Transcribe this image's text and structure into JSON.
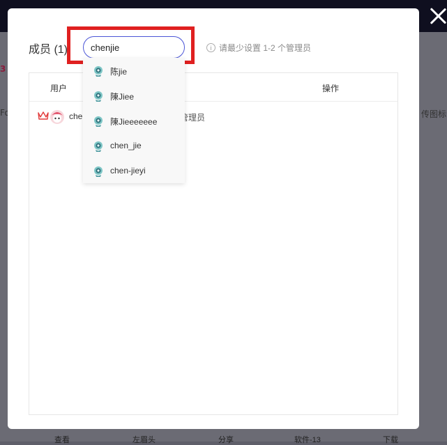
{
  "modal": {
    "title": "成员 (1)",
    "hint": "请最少设置 1-2 个管理员",
    "search": {
      "value": "chenjie"
    }
  },
  "table": {
    "columns": [
      "用户",
      "操作"
    ],
    "rows": [
      {
        "name": "chen",
        "role": "管理员"
      }
    ]
  },
  "dropdown": {
    "items": [
      "陈jie",
      "陳Jiee",
      "陳Jieeeeeee",
      "chen_jie",
      "chen-jieyi"
    ]
  },
  "background": {
    "left_text": "Fo",
    "right_text": "传图标",
    "accent_text": "3",
    "bottom_items": [
      "查看",
      "左眉头",
      "分享",
      "软件-13",
      "下载"
    ]
  },
  "colors": {
    "search_border": "#4a54d6",
    "highlight": "#e02020",
    "overlay_top": "#0f0f1f"
  }
}
